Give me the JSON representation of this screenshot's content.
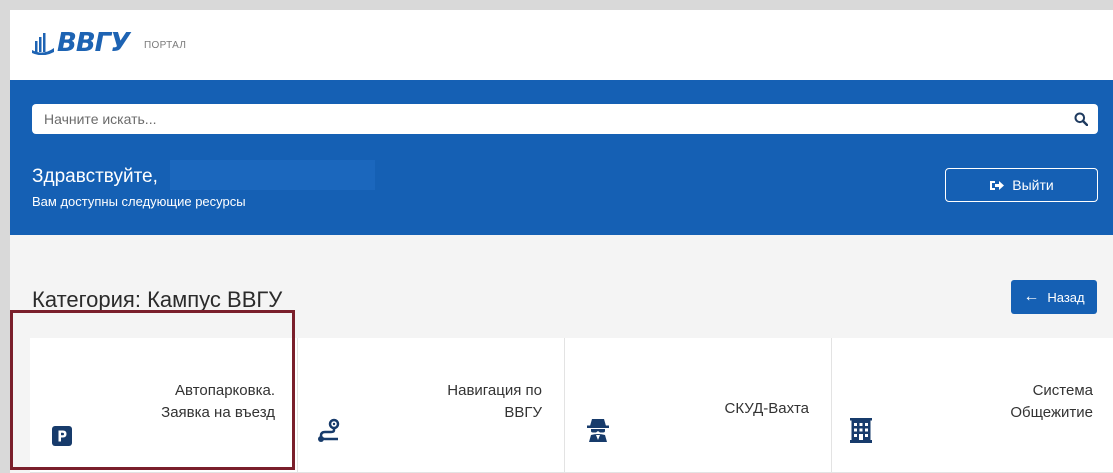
{
  "header": {
    "logo_text": "ВВГУ",
    "portal_label": "ПОРТАЛ"
  },
  "search": {
    "placeholder": "Начните искать..."
  },
  "hero": {
    "greeting": "Здравствуйте,",
    "subtitle": "Вам доступны следующие ресурсы",
    "logout_label": "Выйти"
  },
  "category": {
    "title": "Категория: Кампус ВВГУ",
    "back_label": "Назад"
  },
  "tiles": [
    {
      "line1": "Автопарковка.",
      "line2": "Заявка на въезд",
      "icon": "parking-icon"
    },
    {
      "line1": "Навигация по",
      "line2": "ВВГУ",
      "icon": "route-icon"
    },
    {
      "line1": "СКУД-Вахта",
      "line2": "",
      "icon": "spy-icon"
    },
    {
      "line1": "Система",
      "line2": "Общежитие",
      "icon": "building-icon"
    }
  ],
  "colors": {
    "brand_blue": "#1560b4",
    "highlight_red": "#7a1f2b"
  }
}
